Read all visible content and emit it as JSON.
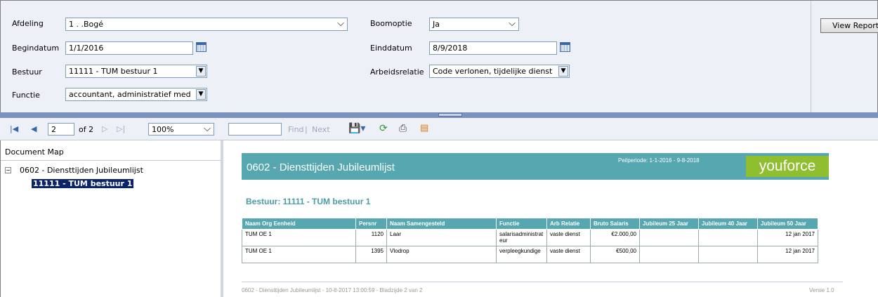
{
  "params": {
    "afdeling": {
      "label": "Afdeling",
      "value": "1 . .Bogé"
    },
    "boomoptie": {
      "label": "Boomoptie",
      "value": "Ja"
    },
    "begindatum": {
      "label": "Begindatum",
      "value": "1/1/2016"
    },
    "einddatum": {
      "label": "Einddatum",
      "value": "8/9/2018"
    },
    "bestuur": {
      "label": "Bestuur",
      "value": "11111 - TUM bestuur 1"
    },
    "arbeidsrelatie": {
      "label": "Arbeidsrelatie",
      "value": "Code verlonen, tijdelijke dienst"
    },
    "functie": {
      "label": "Functie",
      "value": "accountant, administratief med"
    },
    "view_report": "View Report"
  },
  "toolbar": {
    "page_current": "2",
    "page_of": "of 2",
    "zoom": "100%",
    "find_value": "",
    "find_label": "Find",
    "separator": "|",
    "next_label": "Next"
  },
  "docmap": {
    "title": "Document Map",
    "root": "0602 - Diensttijden Jubileumlijst",
    "child": "11111 - TUM bestuur 1"
  },
  "report": {
    "title": "0602 - Diensttijden Jubileumlijst",
    "period": "Peilperiode: 1-1-2016 - 9-8-2018",
    "logo": "youforce",
    "subtitle": "Bestuur: 11111 - TUM bestuur 1",
    "columns": [
      "Naam Org Eenheid",
      "Persnr",
      "Naam Samengesteld",
      "Functie",
      "Arb Relatie",
      "Bruto Salaris",
      "Jubileum 25 Jaar",
      "Jubileum 40 Jaar",
      "Jubileum 50 Jaar"
    ],
    "rows": [
      [
        "TUM OE 1",
        "1120",
        "Laar",
        "salarisadministrateur",
        "vaste dienst",
        "€2.000,00",
        "",
        "",
        "12 jan 2017"
      ],
      [
        "TUM OE 1",
        "1395",
        "Vlodrop",
        "verpleegkundige",
        "vaste dienst",
        "€500,00",
        "",
        "",
        "12 jan 2017"
      ]
    ],
    "footer": "0602 - Diensttijden Jubileumlijst - 10-8-2017 13:00:59 - Bladzijde 2 van 2",
    "version": "Versie 1.0"
  }
}
